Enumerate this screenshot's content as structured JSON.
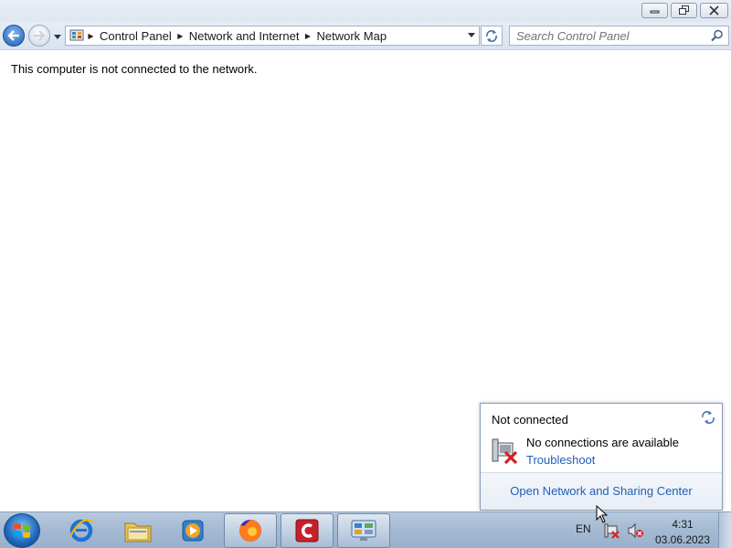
{
  "window": {
    "minimize_icon": "minimize-icon",
    "maximize_icon": "restore-icon",
    "close_icon": "close-icon"
  },
  "navigation": {
    "back_icon": "back-arrow-icon",
    "forward_icon": "forward-arrow-icon",
    "history_icon": "chevron-down-icon",
    "address": {
      "breadcrumbs": [
        "Control Panel",
        "Network and Internet",
        "Network Map"
      ],
      "location_icon": "control-panel-icon"
    },
    "refresh_icon": "refresh-icon",
    "search": {
      "placeholder": "Search Control Panel",
      "value": ""
    }
  },
  "main": {
    "message": "This computer is not connected to the network."
  },
  "network_flyout": {
    "title": "Not connected",
    "status": "No connections are available",
    "troubleshoot_link": "Troubleshoot",
    "open_center_link": "Open Network and Sharing Center"
  },
  "taskbar": {
    "pinned": [
      {
        "name": "internet-explorer",
        "icon": "internet-explorer-icon"
      },
      {
        "name": "windows-explorer",
        "icon": "folder-icon"
      },
      {
        "name": "media-player",
        "icon": "media-player-icon"
      },
      {
        "name": "firefox",
        "icon": "firefox-icon"
      },
      {
        "name": "ccleaner",
        "icon": "ccleaner-icon"
      },
      {
        "name": "control-panel",
        "icon": "control-panel-icon"
      }
    ],
    "tray": {
      "language": "EN",
      "network_icon": "network-disconnected-icon",
      "volume_icon": "volume-muted-icon",
      "time": "4:31",
      "date": "03.06.2023"
    }
  },
  "colors": {
    "link": "#1e5eb8",
    "taskbar": "#a5bbd4",
    "error_red": "#d42121"
  }
}
